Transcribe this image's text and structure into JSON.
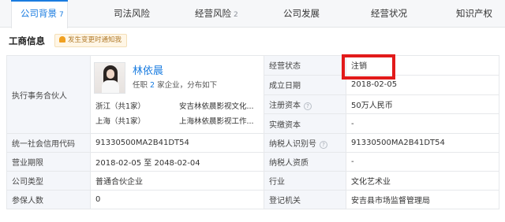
{
  "tabs": [
    {
      "label": "公司背景",
      "count": "7",
      "active": true
    },
    {
      "label": "司法风险",
      "count": "",
      "active": false
    },
    {
      "label": "经营风险",
      "count": "2",
      "active": false
    },
    {
      "label": "公司发展",
      "count": "",
      "active": false
    },
    {
      "label": "经营状况",
      "count": "",
      "active": false
    },
    {
      "label": "知识产权",
      "count": "",
      "active": false
    }
  ],
  "section": {
    "title": "工商信息",
    "notice": "发生变更时通知我"
  },
  "partner": {
    "label": "执行事务合伙人",
    "name": "林依晨",
    "role_prefix": "任职",
    "role_count": "2",
    "role_suffix": "家企业，分布如下",
    "regions": [
      {
        "region": "浙江（共1家）",
        "company": "安吉林依晨影视文化..."
      },
      {
        "region": "上海（共1家）",
        "company": "上海林依晨影视工作..."
      }
    ]
  },
  "fields": {
    "status_label": "经营状态",
    "status_value": "注销",
    "founded_label": "成立日期",
    "founded_value": "2018-02-05",
    "capital_label": "注册资本",
    "capital_value": "50万人民币",
    "paid_label": "实缴资本",
    "paid_value": "-",
    "credit_label": "统一社会信用代码",
    "credit_value": "91330500MA2B41DT54",
    "taxid_label": "纳税人识别号",
    "taxid_value": "91330500MA2B41DT54",
    "term_label": "营业期限",
    "term_value": "2018-02-05 至 2048-02-04",
    "tax_quality_label": "纳税人资质",
    "tax_quality_value": "-",
    "type_label": "公司类型",
    "type_value": "普通合伙企业",
    "industry_label": "行业",
    "industry_value": "文化艺术业",
    "insured_label": "参保人数",
    "insured_value": "0",
    "authority_label": "登记机关",
    "authority_value": "安吉县市场监督管理局"
  },
  "colors": {
    "accent": "#1a7ce0",
    "highlight_box": "#e21a1a",
    "label_bg": "#f4f6fa"
  }
}
